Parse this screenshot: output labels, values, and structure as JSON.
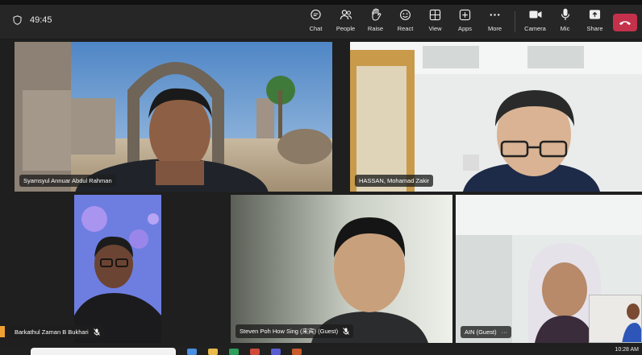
{
  "meeting": {
    "elapsed": "49:45"
  },
  "toolbar": {
    "items": [
      {
        "label": "Chat",
        "icon": "chat-icon"
      },
      {
        "label": "People",
        "icon": "people-icon"
      },
      {
        "label": "Raise",
        "icon": "raise-hand-icon"
      },
      {
        "label": "React",
        "icon": "react-icon"
      },
      {
        "label": "View",
        "icon": "view-icon"
      },
      {
        "label": "Apps",
        "icon": "apps-icon"
      },
      {
        "label": "More",
        "icon": "more-icon"
      },
      {
        "label": "Camera",
        "icon": "camera-icon"
      },
      {
        "label": "Mic",
        "icon": "mic-icon"
      },
      {
        "label": "Share",
        "icon": "share-icon"
      }
    ],
    "leave_icon": "hang-up-icon",
    "leave_color": "#c4314b"
  },
  "participants": [
    {
      "name": "Syamsyul Annuar Abdul Rahman",
      "muted": false
    },
    {
      "name": "HASSAN, Mohamad Zakir",
      "muted": false
    },
    {
      "name": "Barkathul Zaman B Bukhari",
      "muted": true
    },
    {
      "name": "Steven Poh How Sing (来宾) (Guest)",
      "muted": true
    },
    {
      "name": "AIN (Guest)",
      "more": "···"
    }
  ],
  "taskbar": {
    "clock": "10:28 AM"
  }
}
